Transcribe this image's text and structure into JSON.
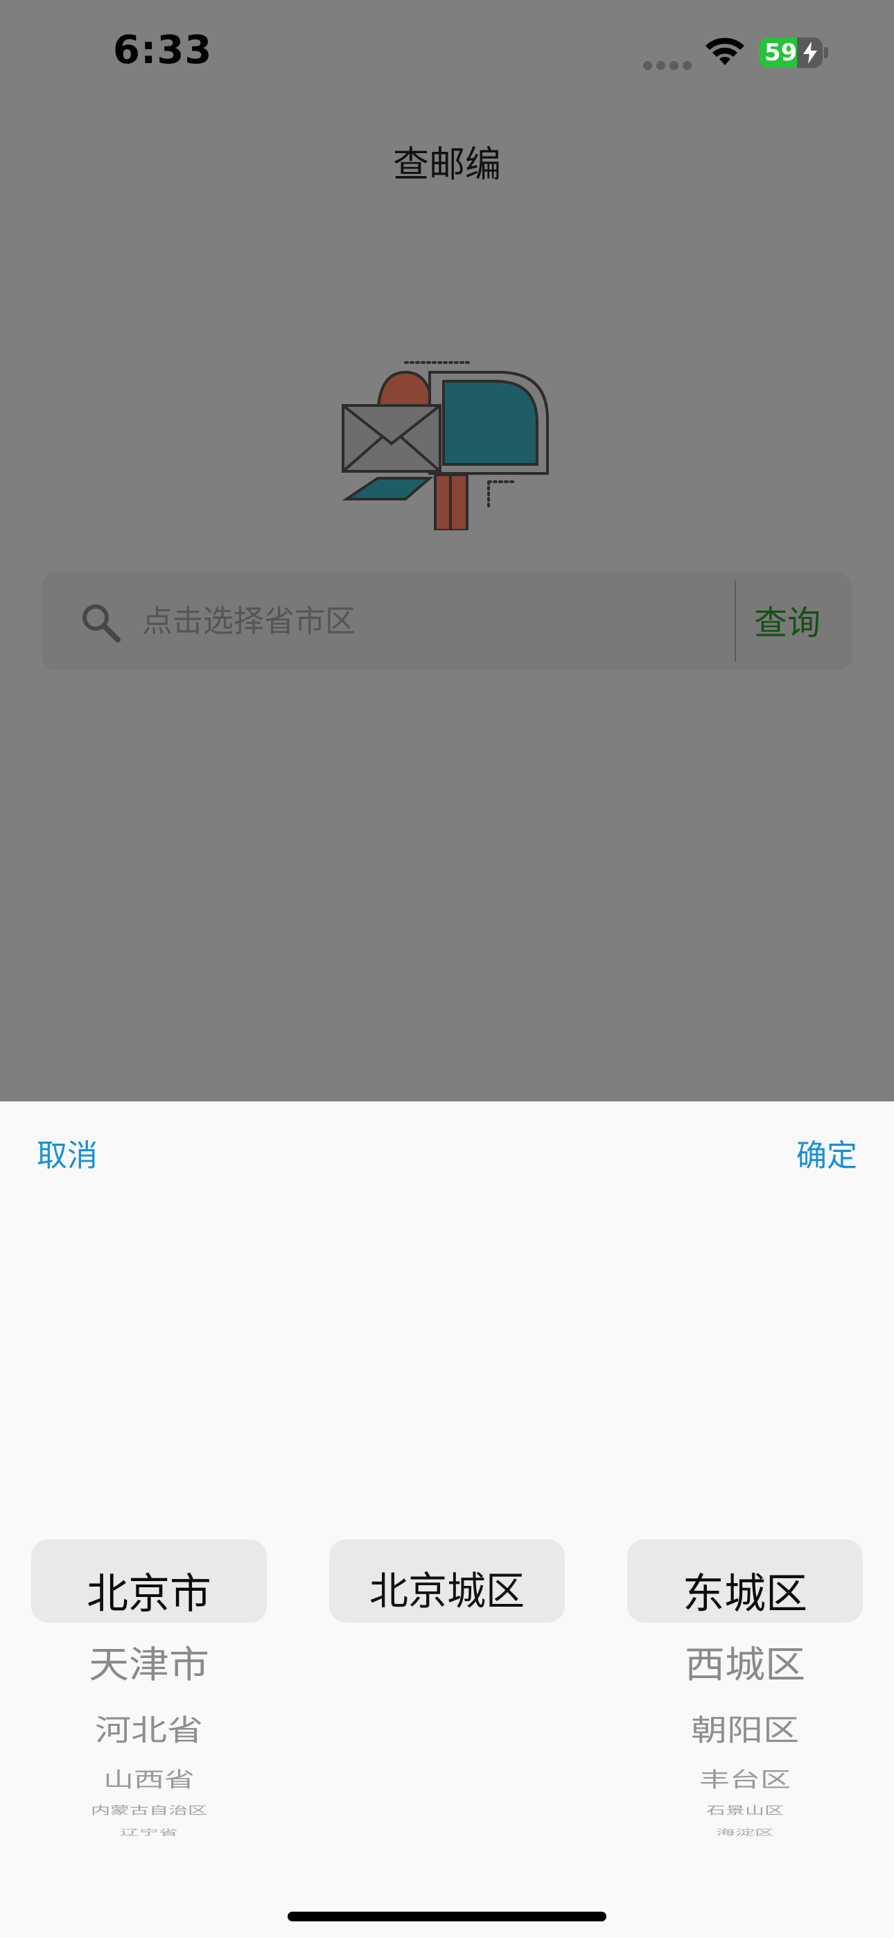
{
  "status_bar": {
    "time": "6:33",
    "battery_level": "59",
    "icons": [
      "cellular-signal-icon",
      "wifi-icon",
      "battery-charging-icon"
    ],
    "battery_color": "#27c23e"
  },
  "header": {
    "title": "查邮编"
  },
  "hero": {
    "icon": "mailbox-icon",
    "colors": [
      "#b4523b",
      "#237a87"
    ]
  },
  "search": {
    "placeholder": "点击选择省市区",
    "icon": "search-icon",
    "query_label": "查询",
    "query_color": "#1e7a1e"
  },
  "picker": {
    "cancel_label": "取消",
    "confirm_label": "确定",
    "accent_color": "#1a8fd8",
    "provinces": [
      "北京市",
      "天津市",
      "河北省",
      "山西省",
      "内蒙古自治区",
      "辽宁省"
    ],
    "cities": [
      "北京城区"
    ],
    "districts": [
      "东城区",
      "西城区",
      "朝阳区",
      "丰台区",
      "石景山区",
      "海淀区"
    ],
    "selected": {
      "province": "北京市",
      "city": "北京城区",
      "district": "东城区"
    }
  }
}
